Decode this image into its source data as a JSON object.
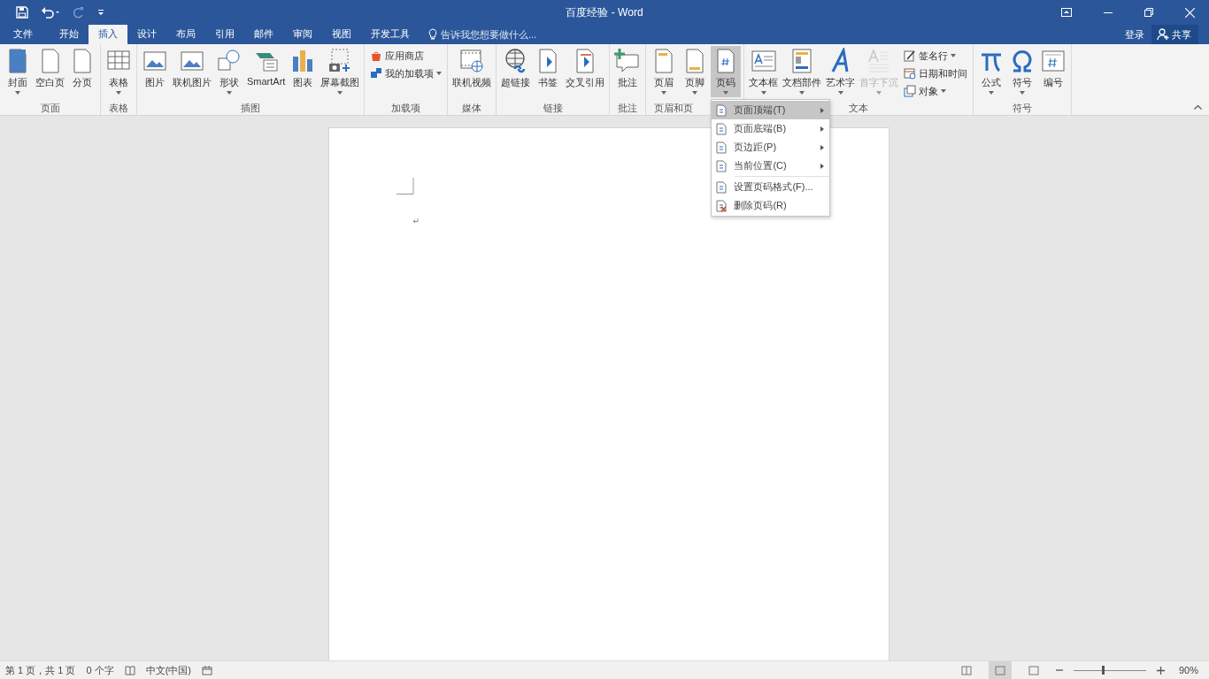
{
  "window": {
    "title": "百度经验 - Word"
  },
  "tabs": [
    {
      "label": "文件",
      "selected": false
    },
    {
      "label": "开始",
      "selected": false
    },
    {
      "label": "插入",
      "selected": true
    },
    {
      "label": "设计",
      "selected": false
    },
    {
      "label": "布局",
      "selected": false
    },
    {
      "label": "引用",
      "selected": false
    },
    {
      "label": "邮件",
      "selected": false
    },
    {
      "label": "审阅",
      "selected": false
    },
    {
      "label": "视图",
      "selected": false
    },
    {
      "label": "开发工具",
      "selected": false
    }
  ],
  "tell_me": {
    "placeholder": "告诉我您想要做什么..."
  },
  "account": {
    "sign_in": "登录",
    "share": "共享"
  },
  "ribbon": {
    "groups": [
      {
        "label": "页面",
        "items": [
          {
            "label": "封面",
            "kind": "large",
            "dropdown": true,
            "selected": false,
            "disabled": false
          },
          {
            "label": "空白页",
            "kind": "large",
            "dropdown": false,
            "selected": false,
            "disabled": false
          },
          {
            "label": "分页",
            "kind": "large",
            "dropdown": false,
            "selected": false,
            "disabled": false
          }
        ]
      },
      {
        "label": "表格",
        "items": [
          {
            "label": "表格",
            "kind": "large",
            "dropdown": true,
            "selected": false,
            "disabled": false
          }
        ]
      },
      {
        "label": "插图",
        "items": [
          {
            "label": "图片",
            "kind": "large",
            "dropdown": false,
            "selected": false,
            "disabled": false
          },
          {
            "label": "联机图片",
            "kind": "large",
            "dropdown": false,
            "selected": false,
            "disabled": false
          },
          {
            "label": "形状",
            "kind": "large",
            "dropdown": true,
            "selected": false,
            "disabled": false
          },
          {
            "label": "SmartArt",
            "kind": "large",
            "dropdown": false,
            "selected": false,
            "disabled": false
          },
          {
            "label": "图表",
            "kind": "large",
            "dropdown": false,
            "selected": false,
            "disabled": false
          },
          {
            "label": "屏幕截图",
            "kind": "large",
            "dropdown": true,
            "selected": false,
            "disabled": false
          }
        ]
      },
      {
        "label": "加载项",
        "items": [
          {
            "label": "应用商店",
            "kind": "small",
            "dropdown": false,
            "selected": false,
            "disabled": false
          },
          {
            "label": "我的加载项",
            "kind": "small",
            "dropdown": true,
            "selected": false,
            "disabled": false
          }
        ]
      },
      {
        "label": "媒体",
        "items": [
          {
            "label": "联机视频",
            "kind": "large",
            "dropdown": false,
            "selected": false,
            "disabled": false
          }
        ]
      },
      {
        "label": "链接",
        "items": [
          {
            "label": "超链接",
            "kind": "large",
            "dropdown": false,
            "selected": false,
            "disabled": false
          },
          {
            "label": "书签",
            "kind": "large",
            "dropdown": false,
            "selected": false,
            "disabled": false
          },
          {
            "label": "交叉引用",
            "kind": "large",
            "dropdown": false,
            "selected": false,
            "disabled": false
          }
        ]
      },
      {
        "label": "批注",
        "items": [
          {
            "label": "批注",
            "kind": "large",
            "dropdown": false,
            "selected": false,
            "disabled": false
          }
        ]
      },
      {
        "label": "页眉和页",
        "items": [
          {
            "label": "页眉",
            "kind": "large",
            "dropdown": true,
            "selected": false,
            "disabled": false
          },
          {
            "label": "页脚",
            "kind": "large",
            "dropdown": true,
            "selected": false,
            "disabled": false
          },
          {
            "label": "页码",
            "kind": "large",
            "dropdown": true,
            "selected": true,
            "disabled": false
          }
        ]
      },
      {
        "label": "文本",
        "items": [
          {
            "label": "文本框",
            "kind": "large",
            "dropdown": true,
            "selected": false,
            "disabled": false
          },
          {
            "label": "文档部件",
            "kind": "large",
            "dropdown": true,
            "selected": false,
            "disabled": false
          },
          {
            "label": "艺术字",
            "kind": "large",
            "dropdown": true,
            "selected": false,
            "disabled": false
          },
          {
            "label": "首字下沉",
            "kind": "large",
            "dropdown": true,
            "selected": false,
            "disabled": true
          },
          {
            "label": "签名行",
            "kind": "small",
            "dropdown": true,
            "selected": false,
            "disabled": false
          },
          {
            "label": "日期和时间",
            "kind": "small",
            "dropdown": false,
            "selected": false,
            "disabled": false
          },
          {
            "label": "对象",
            "kind": "small",
            "dropdown": true,
            "selected": false,
            "disabled": false
          }
        ]
      },
      {
        "label": "符号",
        "items": [
          {
            "label": "公式",
            "kind": "large",
            "dropdown": true,
            "selected": false,
            "disabled": false
          },
          {
            "label": "符号",
            "kind": "large",
            "dropdown": true,
            "selected": false,
            "disabled": false
          },
          {
            "label": "编号",
            "kind": "large",
            "dropdown": false,
            "selected": false,
            "disabled": false
          }
        ]
      }
    ]
  },
  "page_number_menu": {
    "items": [
      {
        "label": "页面顶端(T)",
        "selected": true,
        "submenu": true
      },
      {
        "label": "页面底端(B)",
        "selected": false,
        "submenu": true
      },
      {
        "label": "页边距(P)",
        "selected": false,
        "submenu": true
      },
      {
        "label": "当前位置(C)",
        "selected": false,
        "submenu": true
      },
      {
        "label": "设置页码格式(F)...",
        "selected": false,
        "submenu": false
      },
      {
        "label": "删除页码(R)",
        "selected": false,
        "submenu": false
      }
    ]
  },
  "document": {
    "paragraph_mark": "↵"
  },
  "status_bar": {
    "page": "第 1 页，共 1 页",
    "words": "0 个字",
    "language": "中文(中国)",
    "views": [
      {
        "selected": false
      },
      {
        "selected": true
      },
      {
        "selected": false
      }
    ],
    "zoom": {
      "level": 0.4,
      "reading": "90%"
    }
  }
}
